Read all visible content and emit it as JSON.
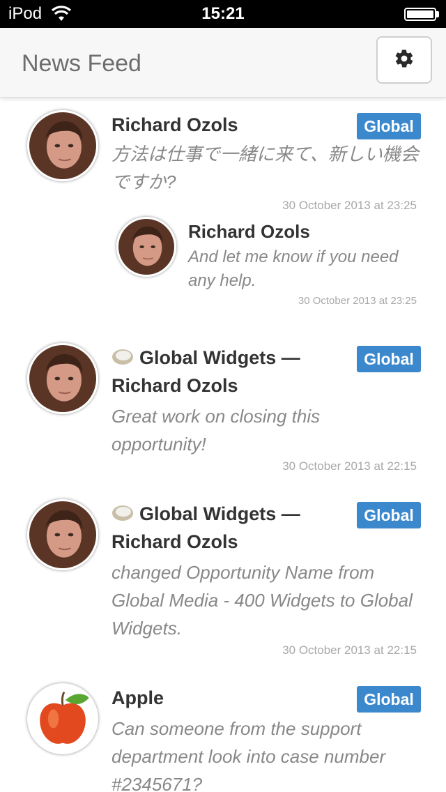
{
  "status_bar": {
    "carrier": "iPod",
    "time": "15:21"
  },
  "header": {
    "title": "News Feed",
    "settings_icon": "gear-icon"
  },
  "feed": [
    {
      "author": "Richard Ozols",
      "badge": "Global",
      "message": "方法は仕事で一緒に来て、新しい機会ですか?",
      "timestamp": "30 October 2013 at 23:25",
      "avatar": "person-avatar",
      "reply": {
        "author": "Richard Ozols",
        "message": "And let me know if you need any help.",
        "timestamp": "30 October 2013 at 23:25",
        "avatar": "person-avatar"
      }
    },
    {
      "group": "Global Widgets —",
      "author": "Richard Ozols",
      "badge": "Global",
      "message": "Great work on closing this opportunity!",
      "timestamp": "30 October 2013 at 22:15",
      "avatar": "person-avatar",
      "group_icon": "group-icon"
    },
    {
      "group": "Global Widgets —",
      "author": "Richard Ozols",
      "badge": "Global",
      "message": "changed Opportunity Name from Global Media - 400 Widgets to Global Widgets.",
      "timestamp": "30 October 2013 at 22:15",
      "avatar": "person-avatar",
      "group_icon": "group-icon"
    },
    {
      "author": "Apple",
      "badge": "Global",
      "message": "Can someone from the support department look into case number #2345671?",
      "avatar": "apple-avatar"
    }
  ],
  "colors": {
    "badge": "#3b88cc",
    "header_bg": "#f7f7f7",
    "message_text": "#888888",
    "timestamp_text": "#a8a8a8"
  }
}
